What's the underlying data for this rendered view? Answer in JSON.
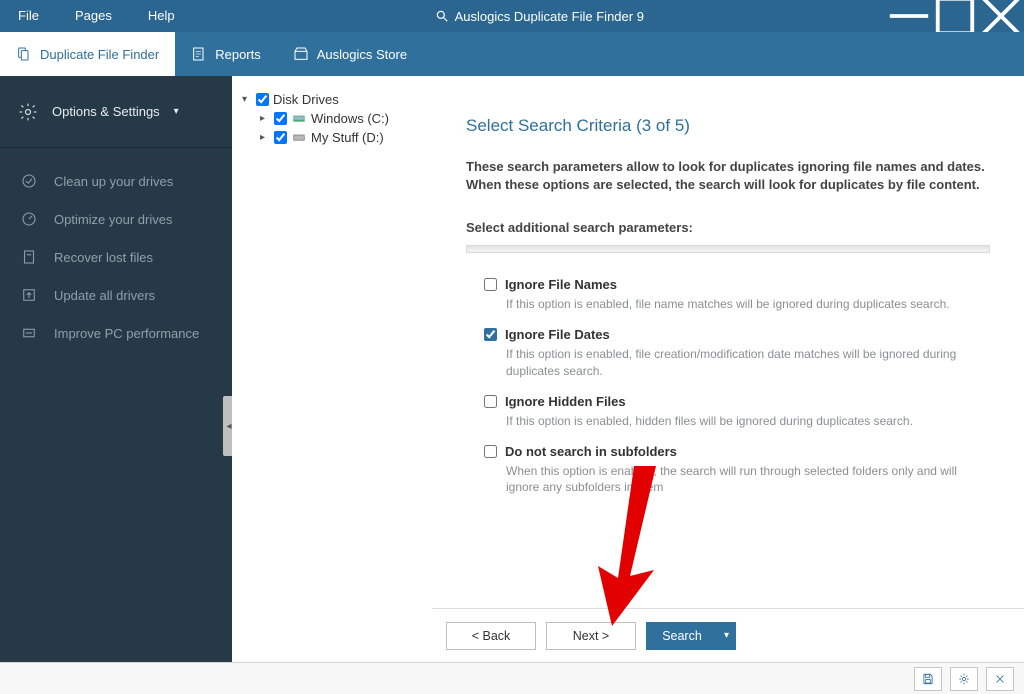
{
  "titlebar": {
    "menu": [
      "File",
      "Pages",
      "Help"
    ],
    "title": "Auslogics Duplicate File Finder 9"
  },
  "tabs": [
    {
      "label": "Duplicate File Finder",
      "active": true,
      "icon": "files-icon"
    },
    {
      "label": "Reports",
      "active": false,
      "icon": "report-icon"
    },
    {
      "label": "Auslogics Store",
      "active": false,
      "icon": "store-icon"
    }
  ],
  "sidebar": {
    "options_label": "Options & Settings",
    "links": [
      {
        "label": "Clean up your drives",
        "icon": "broom-icon"
      },
      {
        "label": "Optimize your drives",
        "icon": "gauge-icon"
      },
      {
        "label": "Recover lost files",
        "icon": "recover-icon"
      },
      {
        "label": "Update all drivers",
        "icon": "update-icon"
      },
      {
        "label": "Improve PC performance",
        "icon": "speed-icon"
      }
    ]
  },
  "tree": {
    "root": "Disk Drives",
    "items": [
      {
        "label": "Windows (C:)",
        "checked": true
      },
      {
        "label": "My Stuff (D:)",
        "checked": true
      }
    ]
  },
  "wizard": {
    "heading_prefix": "Select Search Criteria",
    "heading_counter": "(3 of 5)",
    "description": "These search parameters allow to look for duplicates ignoring file names and dates. When these options are selected, the search will look for duplicates by file content.",
    "sub_label": "Select additional search parameters:",
    "options": [
      {
        "label": "Ignore File Names",
        "checked": false,
        "hint": "If this option is enabled, file name matches will be ignored during duplicates search."
      },
      {
        "label": "Ignore File Dates",
        "checked": true,
        "hint": "If this option is enabled, file creation/modification date matches will be ignored during duplicates search."
      },
      {
        "label": "Ignore Hidden Files",
        "checked": false,
        "hint": "If this option is enabled, hidden files will be ignored during duplicates search."
      },
      {
        "label": "Do not search in subfolders",
        "checked": false,
        "hint": "When this option is enabled, the search will run through selected folders only and will ignore any subfolders in them"
      }
    ],
    "buttons": {
      "back": "< Back",
      "next": "Next >",
      "search": "Search"
    }
  }
}
